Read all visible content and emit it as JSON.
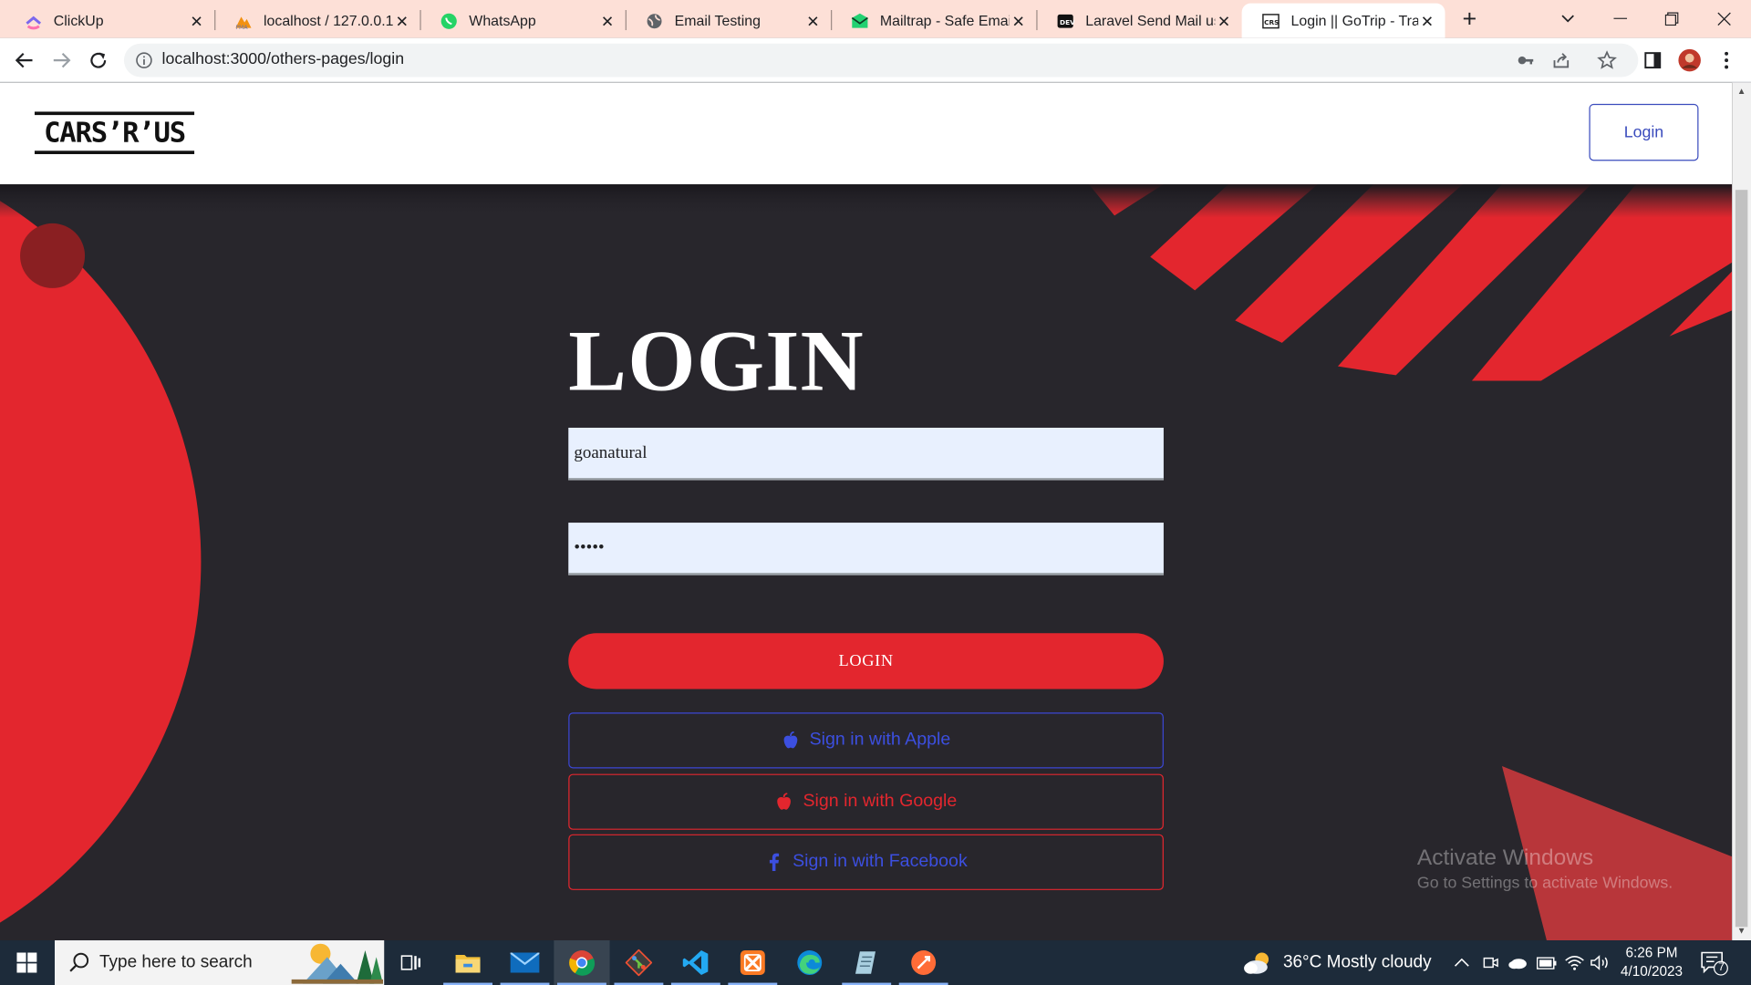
{
  "browser": {
    "tabs": [
      {
        "title": "ClickUp",
        "icon": "clickup-icon",
        "active": false
      },
      {
        "title": "localhost / 127.0.0.1 /",
        "icon": "phpmyadmin-icon",
        "active": false
      },
      {
        "title": "WhatsApp",
        "icon": "whatsapp-icon",
        "active": false
      },
      {
        "title": "Email Testing",
        "icon": "globe-icon",
        "active": false
      },
      {
        "title": "Mailtrap - Safe Email T",
        "icon": "mailtrap-icon",
        "active": false
      },
      {
        "title": "Laravel Send Mail usir",
        "icon": "dev-icon",
        "active": false
      },
      {
        "title": "Login || GoTrip - Trave",
        "icon": "gotrip-icon",
        "active": true
      }
    ],
    "new_tab": "+",
    "url": "localhost:3000/others-pages/login"
  },
  "site": {
    "logo_text": "CARS’R’US",
    "nav_login": "Login",
    "title": "LOGIN",
    "username_value": "goanatural",
    "password_value": "•••••",
    "submit_label": "LOGIN",
    "social": {
      "apple": "Sign in with Apple",
      "google": "Sign in with Google",
      "facebook": "Sign in with Facebook"
    },
    "accent_color": "#e3262e",
    "link_color": "#3c4fe0"
  },
  "watermark": {
    "title": "Activate Windows",
    "subtitle": "Go to Settings to activate Windows."
  },
  "taskbar": {
    "search_placeholder": "Type here to search",
    "weather": "36°C  Mostly cloudy",
    "time": "6:26 PM",
    "date": "4/10/2023",
    "notification_count": "7",
    "apps": [
      "task-view-icon",
      "file-explorer-icon",
      "mail-icon",
      "chrome-icon",
      "git-icon",
      "vscode-icon",
      "xampp-icon",
      "edge-icon",
      "notepad-icon",
      "postman-icon"
    ]
  }
}
